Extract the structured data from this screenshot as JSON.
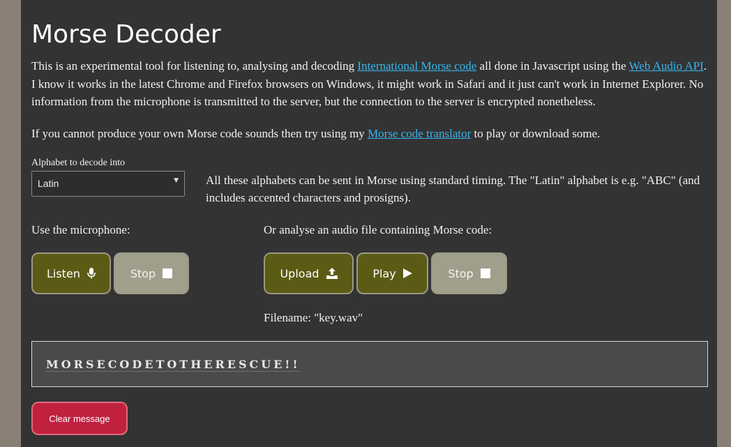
{
  "page": {
    "title": "Morse Decoder",
    "intro": {
      "t1": "This is an experimental tool for listening to, analysing and decoding ",
      "link1": "International Morse code",
      "t2": " all done in Javascript using the ",
      "link2": "Web Audio API",
      "t3": ". I know it works in the latest Chrome and Firefox browsers on Windows, it might work in Safari and it just can't work in Internet Explorer. No information from the microphone is transmitted to the server, but the connection to the server is encrypted nonetheless."
    },
    "tip": {
      "t1": "If you cannot produce your own Morse code sounds then try using my ",
      "link": "Morse code translator",
      "t2": " to play or download some."
    }
  },
  "alphabet": {
    "label": "Alphabet to decode into",
    "selected": "Latin",
    "note": "All these alphabets can be sent in Morse using standard timing. The \"Latin\" alphabet is e.g. \"ABC\" (and includes accented characters and prosigns)."
  },
  "microphone": {
    "label": "Use the microphone:",
    "listen_label": "Listen",
    "stop_label": "Stop"
  },
  "file": {
    "label": "Or analyse an audio file containing Morse code:",
    "upload_label": "Upload",
    "play_label": "Play",
    "stop_label": "Stop",
    "filename": "Filename: \"key.wav\""
  },
  "output": {
    "message": "MORSECODETOTHERESCUE!!"
  },
  "clear": {
    "label": "Clear message"
  },
  "colors": {
    "panel": "#333333",
    "link": "#36b6f0",
    "button_primary": "#5c5b15",
    "button_disabled": "#a09f8c",
    "clear_button": "#c0213f"
  },
  "icons": {
    "listen": "microphone-icon",
    "stop": "stop-square-icon",
    "upload": "upload-icon",
    "play": "play-icon"
  }
}
